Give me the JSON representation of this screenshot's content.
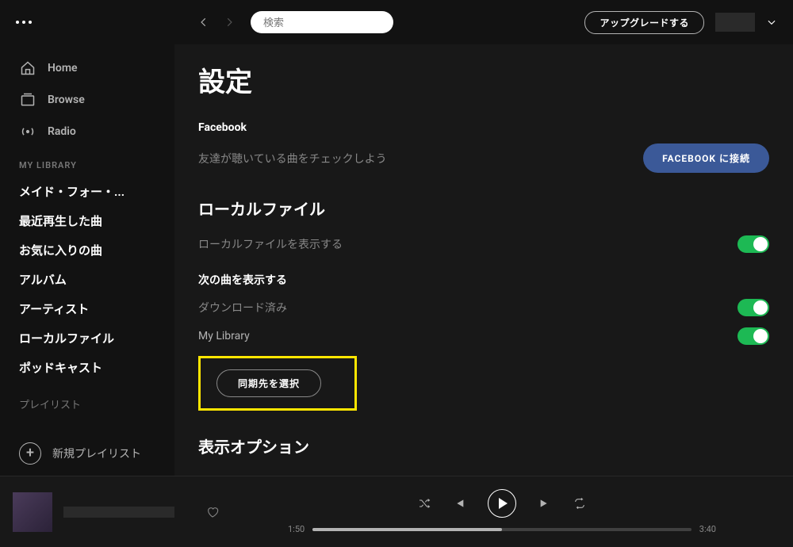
{
  "search": {
    "placeholder": "検索"
  },
  "topbar": {
    "upgrade": "アップグレードする"
  },
  "sidebar": {
    "nav": [
      {
        "label": "Home"
      },
      {
        "label": "Browse"
      },
      {
        "label": "Radio"
      }
    ],
    "section_title": "MY LIBRARY",
    "lib_items": [
      "メイド・フォー・...",
      "最近再生した曲",
      "お気に入りの曲",
      "アルバム",
      "アーティスト",
      "ローカルファイル",
      "ポッドキャスト"
    ],
    "playlist_title": "プレイリスト",
    "new_playlist": "新規プレイリスト"
  },
  "settings": {
    "title": "設定",
    "facebook": {
      "label": "Facebook",
      "desc": "友達が聴いている曲をチェックしよう",
      "button": "FACEBOOK に接続"
    },
    "local": {
      "heading": "ローカルファイル",
      "show_label": "ローカルファイルを表示する"
    },
    "show_songs": {
      "heading": "次の曲を表示する",
      "downloaded": "ダウンロード済み",
      "my_library": "My Library",
      "sync_button": "同期先を選択"
    },
    "display_options": {
      "heading": "表示オプション"
    }
  },
  "player": {
    "elapsed": "1:50",
    "duration": "3:40"
  }
}
